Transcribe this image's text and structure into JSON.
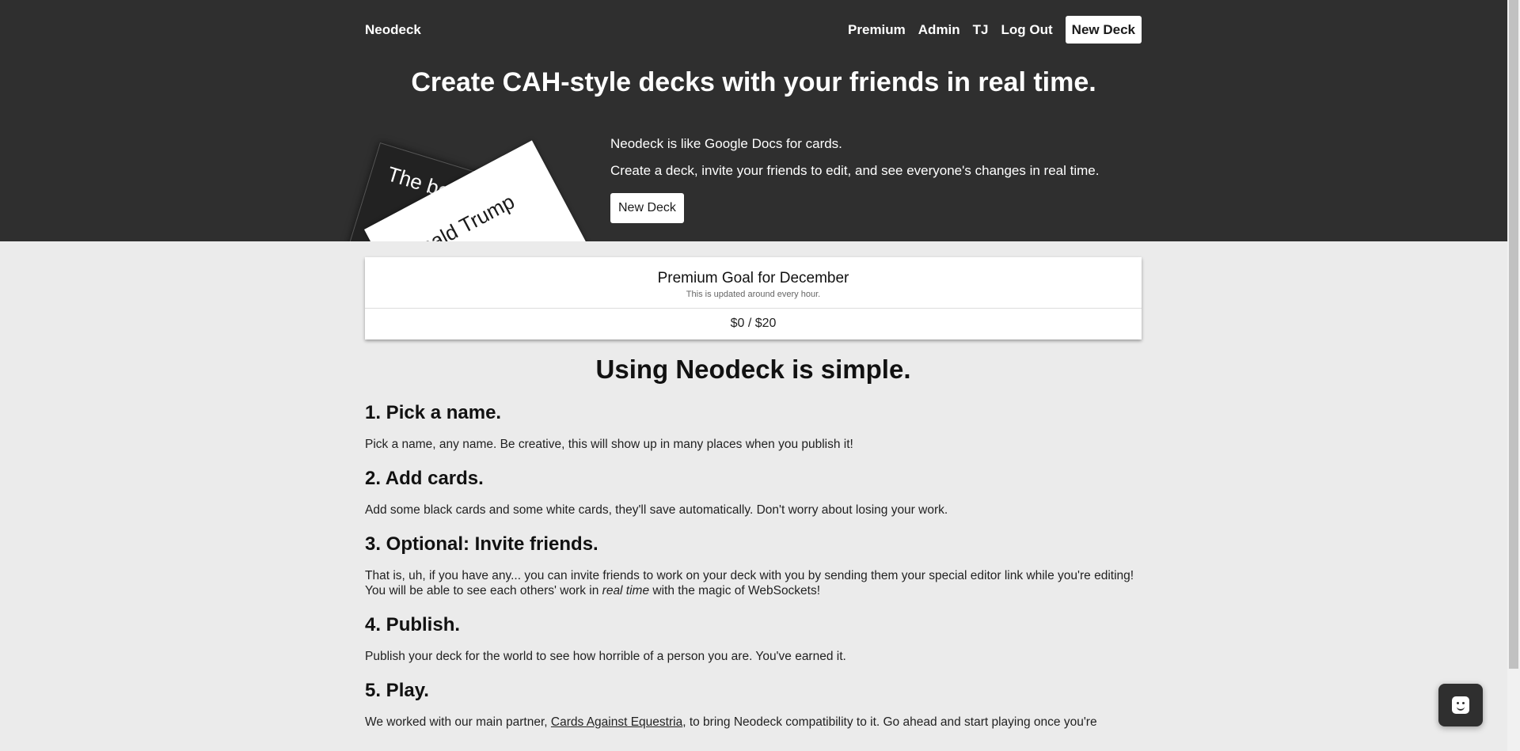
{
  "nav": {
    "brand": "Neodeck",
    "links": [
      "Premium",
      "Admin",
      "TJ",
      "Log Out"
    ],
    "new_deck": "New Deck"
  },
  "hero": {
    "title": "Create CAH-style decks with your friends in real time.",
    "black_card_text": "The best cure",
    "white_card_text": "Donald Trump",
    "line1": "Neodeck is like Google Docs for cards.",
    "line2": "Create a deck, invite your friends to edit, and see everyone's changes in real time.",
    "button": "New Deck"
  },
  "goal": {
    "title": "Premium Goal for December",
    "subtitle": "This is updated around every hour.",
    "amount": "$0 / $20"
  },
  "content": {
    "heading": "Using Neodeck is simple.",
    "steps": [
      {
        "title": "1. Pick a name.",
        "text": "Pick a name, any name. Be creative, this will show up in many places when you publish it!"
      },
      {
        "title": "2. Add cards.",
        "text": "Add some black cards and some white cards, they'll save automatically. Don't worry about losing your work."
      },
      {
        "title": "3. Optional: Invite friends.",
        "text_before": "That is, uh, if you have any... you can invite friends to work on your deck with you by sending them your special editor link while you're editing! You will be able to see each others' work in ",
        "em": "real time",
        "text_after": " with the magic of WebSockets!"
      },
      {
        "title": "4. Publish.",
        "text": "Publish your deck for the world to see how horrible of a person you are. You've earned it."
      },
      {
        "title": "5. Play.",
        "text_before": "We worked with our main partner, ",
        "link": "Cards Against Equestria",
        "text_after": ", to bring Neodeck compatibility to it. Go ahead and start playing once you're"
      }
    ]
  },
  "colors": {
    "hero_bg": "#2f2f2f",
    "page_bg": "#ebebeb"
  },
  "icons": {
    "chat": "smiley-chat-icon"
  }
}
